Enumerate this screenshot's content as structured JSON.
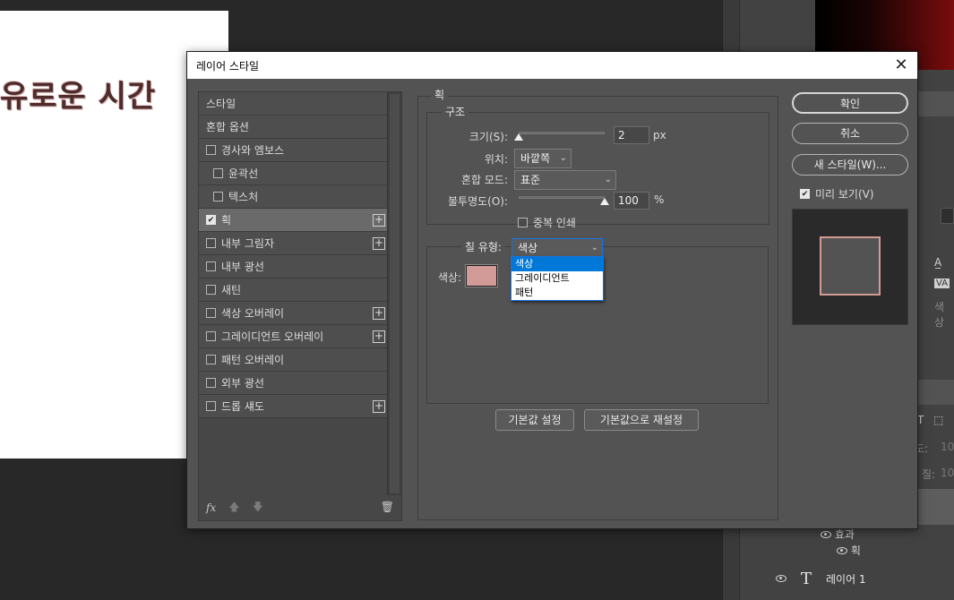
{
  "document": {
    "text": "유로운 시간"
  },
  "background_panel": {
    "layer_effects_label": "효과",
    "layer_stroke_label": "획",
    "layer_name": "레이어 1",
    "opacity_label": "도:",
    "fill_label": "질:",
    "field_value": "10",
    "color_label": "색상"
  },
  "dialog": {
    "title": "레이어 스타일",
    "styles": [
      {
        "label": "스타일",
        "checkbox": false,
        "checked": false,
        "indent": false,
        "plus": false,
        "selected": false
      },
      {
        "label": "혼합 옵션",
        "checkbox": false,
        "checked": false,
        "indent": false,
        "plus": false,
        "selected": false
      },
      {
        "label": "경사와 엠보스",
        "checkbox": true,
        "checked": false,
        "indent": false,
        "plus": false,
        "selected": false
      },
      {
        "label": "윤곽선",
        "checkbox": true,
        "checked": false,
        "indent": true,
        "plus": false,
        "selected": false
      },
      {
        "label": "텍스처",
        "checkbox": true,
        "checked": false,
        "indent": true,
        "plus": false,
        "selected": false
      },
      {
        "label": "획",
        "checkbox": true,
        "checked": true,
        "indent": false,
        "plus": true,
        "selected": true
      },
      {
        "label": "내부 그림자",
        "checkbox": true,
        "checked": false,
        "indent": false,
        "plus": true,
        "selected": false
      },
      {
        "label": "내부 광선",
        "checkbox": true,
        "checked": false,
        "indent": false,
        "plus": false,
        "selected": false
      },
      {
        "label": "새틴",
        "checkbox": true,
        "checked": false,
        "indent": false,
        "plus": false,
        "selected": false
      },
      {
        "label": "색상 오버레이",
        "checkbox": true,
        "checked": false,
        "indent": false,
        "plus": true,
        "selected": false
      },
      {
        "label": "그레이디언트 오버레이",
        "checkbox": true,
        "checked": false,
        "indent": false,
        "plus": true,
        "selected": false
      },
      {
        "label": "패턴 오버레이",
        "checkbox": true,
        "checked": false,
        "indent": false,
        "plus": false,
        "selected": false
      },
      {
        "label": "외부 광선",
        "checkbox": true,
        "checked": false,
        "indent": false,
        "plus": false,
        "selected": false
      },
      {
        "label": "드롭 섀도",
        "checkbox": true,
        "checked": false,
        "indent": false,
        "plus": true,
        "selected": false
      }
    ],
    "footer": {
      "fx": "fx",
      "up": "🡅",
      "down": "🡇",
      "trash": "🗑"
    },
    "stroke": {
      "title": "획",
      "structure_title": "구조",
      "size_label": "크기(S):",
      "size_value": "2",
      "size_unit": "px",
      "size_fraction": 0.0,
      "position_label": "위치:",
      "position_value": "바깥쪽",
      "blend_label": "혼합 모드:",
      "blend_value": "표준",
      "opacity_label": "불투명도(O):",
      "opacity_value": "100",
      "opacity_unit": "%",
      "opacity_fraction": 1.0,
      "overprint_label": "중복 인쇄",
      "fill_type_label": "칠 유형:",
      "fill_type_value": "색상",
      "fill_type_options": [
        "색상",
        "그레이디언트",
        "패턴"
      ],
      "fill_type_selected": 0,
      "color_label": "색상:",
      "color_hex": "#d39b98",
      "reset_default": "기본값 설정",
      "reset_to_default": "기본값으로 재설정"
    },
    "buttons": {
      "ok": "확인",
      "cancel": "취소",
      "new_style": "새 스타일(W)...",
      "preview_label": "미리 보기(V)",
      "preview_checked": true
    }
  }
}
